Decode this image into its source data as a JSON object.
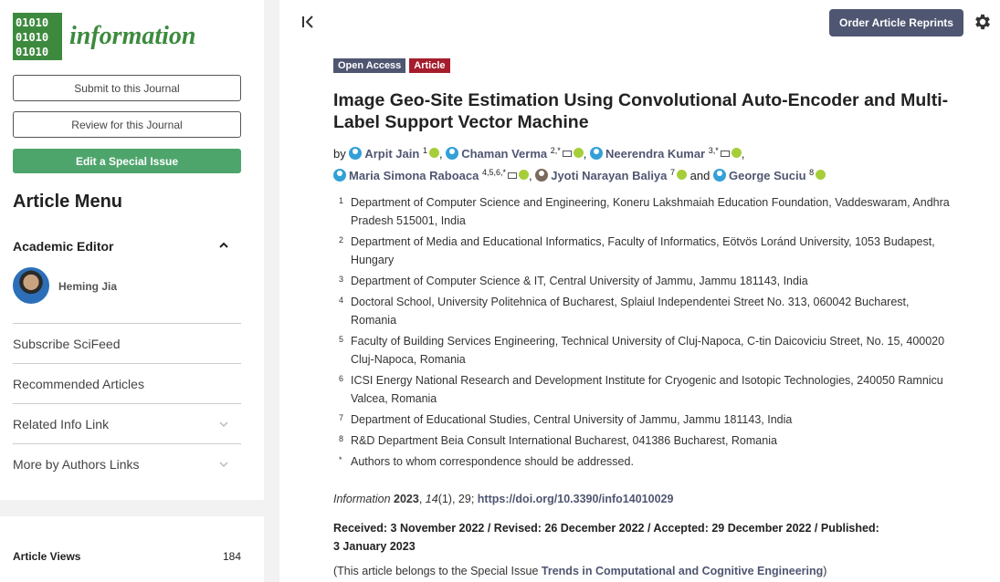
{
  "sidebar": {
    "logo_bits": [
      "01010",
      "01010",
      "01010"
    ],
    "logo_text": "information",
    "submit_label": "Submit to this Journal",
    "review_label": "Review for this Journal",
    "special_issue_label": "Edit a Special Issue",
    "menu_title": "Article Menu",
    "academic_editor_title": "Academic Editor",
    "editor_name": "Heming Jia",
    "items": [
      {
        "label": "Subscribe SciFeed"
      },
      {
        "label": "Recommended Articles"
      },
      {
        "label": "Related Info Link"
      },
      {
        "label": "More by Authors Links"
      }
    ],
    "views_label": "Article Views",
    "views_value": "184"
  },
  "header": {
    "reprint_label": "Order Article Reprints"
  },
  "article": {
    "badge_open": "Open Access",
    "badge_type": "Article",
    "title": "Image Geo-Site Estimation Using Convolutional Auto-Encoder and Multi-Label Support Vector Machine",
    "by": "by",
    "authors": [
      {
        "name": "Arpit Jain",
        "sup": "1"
      },
      {
        "name": "Chaman Verma",
        "sup": "2,*"
      },
      {
        "name": "Neerendra Kumar",
        "sup": "3,*"
      },
      {
        "name": "Maria Simona Raboaca",
        "sup": "4,5,6,*"
      },
      {
        "name": "Jyoti Narayan Baliya",
        "sup": "7"
      },
      {
        "name": "George Suciu",
        "sup": "8"
      }
    ],
    "and": "and",
    "affiliations": [
      {
        "num": "1",
        "text": "Department of Computer Science and Engineering, Koneru Lakshmaiah Education Foundation, Vaddeswaram, Andhra Pradesh 515001, India"
      },
      {
        "num": "2",
        "text": "Department of Media and Educational Informatics, Faculty of Informatics, Eötvös Loránd University, 1053 Budapest, Hungary"
      },
      {
        "num": "3",
        "text": "Department of Computer Science & IT, Central University of Jammu, Jammu 181143, India"
      },
      {
        "num": "4",
        "text": "Doctoral School, University Politehnica of Bucharest, Splaiul Independentei Street No. 313, 060042 Bucharest, Romania"
      },
      {
        "num": "5",
        "text": "Faculty of Building Services Engineering, Technical University of Cluj-Napoca, C-tin Daicoviciu Street, No. 15, 400020 Cluj-Napoca, Romania"
      },
      {
        "num": "6",
        "text": "ICSI Energy National Research and Development Institute for Cryogenic and Isotopic Technologies, 240050 Ramnicu Valcea, Romania"
      },
      {
        "num": "7",
        "text": "Department of Educational Studies, Central University of Jammu, Jammu 181143, India"
      },
      {
        "num": "8",
        "text": "R&D Department Beia Consult International Bucharest, 041386 Bucharest, Romania"
      },
      {
        "num": "*",
        "text": "Authors to whom correspondence should be addressed."
      }
    ],
    "citation_journal": "Information",
    "citation_year": "2023",
    "citation_rest_a": ", ",
    "citation_volume": "14",
    "citation_rest_b": "(1), 29; ",
    "doi": "https://doi.org/10.3390/info14010029",
    "dates": "Received: 3 November 2022 / Revised: 26 December 2022 / Accepted: 29 December 2022 / Published: 3 January 2023",
    "special_prefix": "(This article belongs to the Special Issue ",
    "special_link": "Trends in Computational and Cognitive Engineering",
    "special_suffix": ")"
  }
}
